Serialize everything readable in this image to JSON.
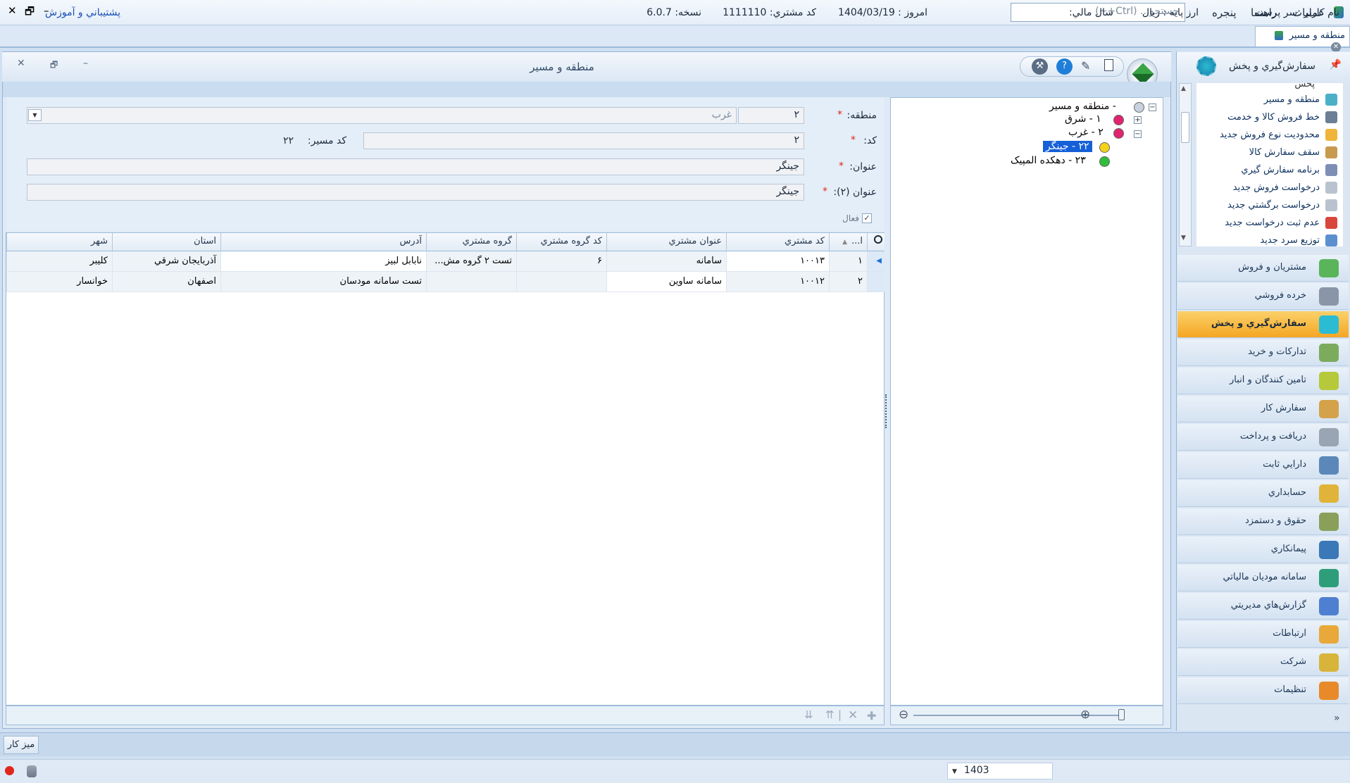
{
  "menu": {
    "ops": "عملیات",
    "help": "راهنما",
    "window": "پنجره",
    "search_placeholder": "جستجو... (Ctrl+~)"
  },
  "doc_tab": {
    "label": "منطقه و مسير"
  },
  "window": {
    "title": "منطقه و مسير"
  },
  "form": {
    "region_label": "منطقه:",
    "region_code": "۲",
    "region_name": "غرب",
    "code_label": "کد:",
    "code_value": "۲",
    "route_code_label": "کد مسير:",
    "route_code_value": "۲۲",
    "title_label": "عنوان:",
    "title_value": "جينگر",
    "title2_label": "عنوان (۲):",
    "title2_value": "جينگر",
    "active_label": "فعال"
  },
  "grid": {
    "headers": [
      "ا...",
      "کد مشتري",
      "عنوان مشتري",
      "کد گروه مشتري",
      "گروه مشتري",
      "آدرس",
      "استان",
      "شهر"
    ],
    "rows": [
      {
        "idx": "۱",
        "code": "۱۰۰۱۳",
        "name": "سامانه",
        "gcode": "۶",
        "group": "تست ۲ گروه مش...",
        "address": "نابابل لبيز",
        "province": "آذربايجان شرقي",
        "city": "کلیبر"
      },
      {
        "idx": "۲",
        "code": "۱۰۰۱۲",
        "name": "سامانه ساوين",
        "gcode": "",
        "group": "",
        "address": "تست سامانه مودسان",
        "province": "اصفهان",
        "city": "خوانسار"
      }
    ]
  },
  "tree": {
    "root": "- منطقه و مسير",
    "n1": "۱ - شرق",
    "n2": "۲ - غرب",
    "n21": "۲۲ - جينگر",
    "n22": "۲۳ - دهکده المپیک"
  },
  "nav": {
    "head": "سفارش‌گيري و پخش",
    "list_top": "پخش",
    "list": [
      "منطقه و مسير",
      "خط فروش کالا و خدمت",
      "محدوديت نوع فروش جديد",
      "سقف سفارش کالا",
      "برنامه سفارش گيري",
      "درخواست فروش جديد",
      "درخواست برگشتي جديد",
      "عدم ثبت درخواست جديد",
      "توزيع سرد جديد"
    ],
    "modules": [
      "مشتريان و فروش",
      "خرده فروشي",
      "سفارش‌گيري و پخش",
      "تدارکات و خريد",
      "تامين کنندگان و انبار",
      "سفارش کار",
      "دريافت و پرداخت",
      "دارايي ثابت",
      "حسابداري",
      "حقوق و دستمزد",
      "پيمانکاري",
      "سامانه موديان مالياتي",
      "گزارش‌هاي مديريتي",
      "ارتباطات",
      "شرکت",
      "تنظيمات"
    ]
  },
  "taskbar": {
    "desk": "ميز کار"
  },
  "status": {
    "user": "نام کاربر :سر پرست",
    "currency": "ارز پايه :  ريال",
    "fyear_label": "سال مالي:",
    "fyear": "1403",
    "today": "امروز :  1404/03/19",
    "cust_code": "کد مشتري:  1111110",
    "version": "نسخه:  6.0.7",
    "support": "پشتيباني و آموزش"
  },
  "colors": {
    "accent": "#f5a623",
    "selected": "#1560d8",
    "link": "#1a4fb5"
  }
}
